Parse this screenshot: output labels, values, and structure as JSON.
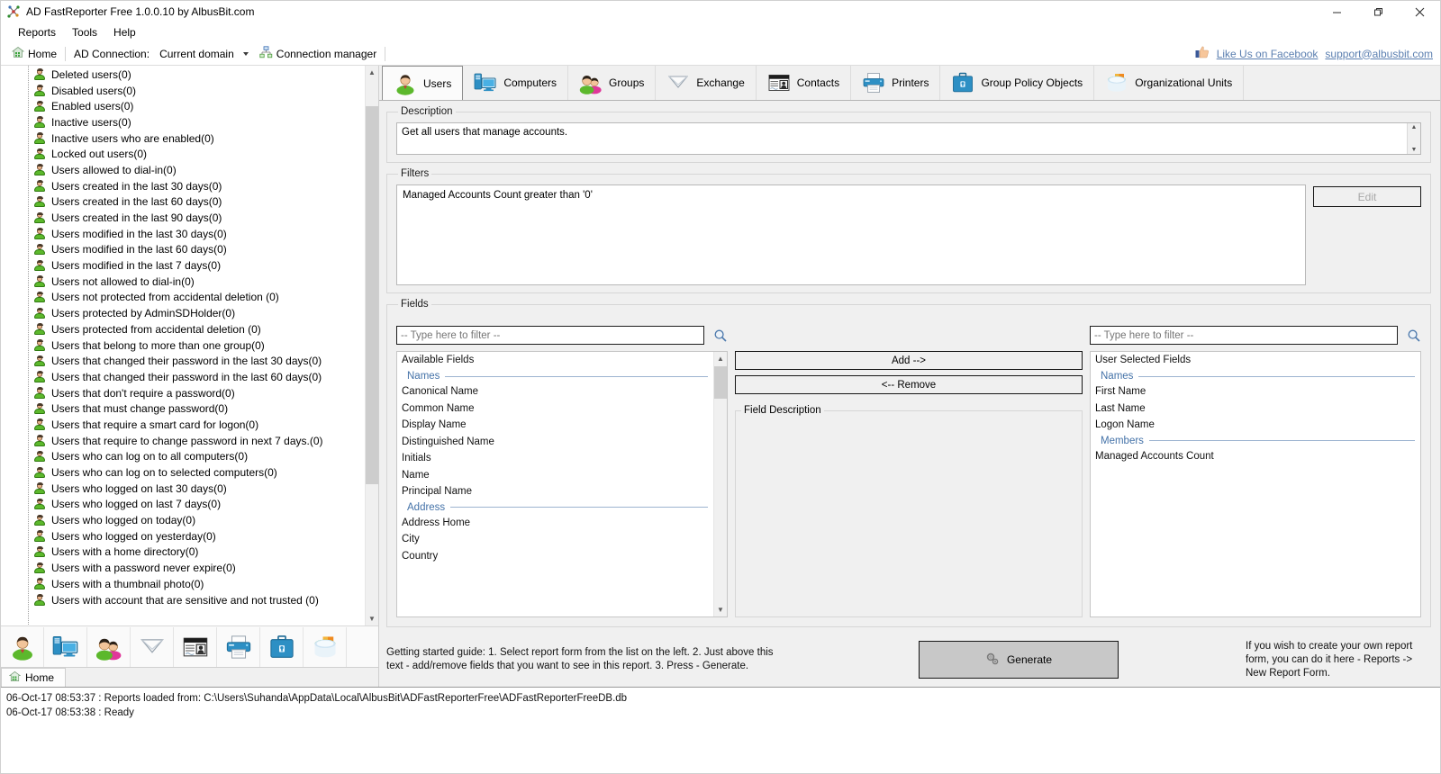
{
  "window": {
    "title": "AD FastReporter Free 1.0.0.10 by AlbusBit.com",
    "minimize": "–",
    "maximize": "❐",
    "close": "✕"
  },
  "menu": {
    "items": [
      {
        "label": "Reports"
      },
      {
        "label": "Tools"
      },
      {
        "label": "Help"
      }
    ]
  },
  "toolbar": {
    "home_label": "Home",
    "ad_connection_label": "AD Connection:",
    "connection_value": "Current domain",
    "connection_manager_label": "Connection manager",
    "facebook_link": "Like Us on Facebook",
    "support_link": "support@albusbit.com"
  },
  "tree": {
    "items": [
      {
        "label": "Deleted users(0)"
      },
      {
        "label": "Disabled users(0)"
      },
      {
        "label": "Enabled users(0)"
      },
      {
        "label": "Inactive users(0)"
      },
      {
        "label": "Inactive users who are enabled(0)"
      },
      {
        "label": "Locked out users(0)"
      },
      {
        "label": "Users allowed to dial-in(0)"
      },
      {
        "label": "Users created in the last 30 days(0)"
      },
      {
        "label": "Users created in the last 60 days(0)"
      },
      {
        "label": "Users created in the last 90 days(0)"
      },
      {
        "label": "Users modified in the last 30 days(0)"
      },
      {
        "label": "Users modified in the last 60 days(0)"
      },
      {
        "label": "Users modified in the last 7 days(0)"
      },
      {
        "label": "Users not allowed to dial-in(0)"
      },
      {
        "label": "Users not protected from accidental deletion (0)"
      },
      {
        "label": "Users protected by AdminSDHolder(0)"
      },
      {
        "label": "Users protected from accidental deletion (0)"
      },
      {
        "label": "Users that belong to more than one group(0)"
      },
      {
        "label": "Users that changed their password in the last 30 days(0)"
      },
      {
        "label": "Users that changed their password in the last 60 days(0)"
      },
      {
        "label": "Users that don't require a password(0)"
      },
      {
        "label": "Users that must change password(0)"
      },
      {
        "label": "Users that require a smart card for logon(0)"
      },
      {
        "label": "Users that require to change password in next 7 days.(0)"
      },
      {
        "label": "Users who can log on to all computers(0)"
      },
      {
        "label": "Users who can log on to selected computers(0)"
      },
      {
        "label": "Users who logged on last 30 days(0)"
      },
      {
        "label": "Users who logged on last 7 days(0)"
      },
      {
        "label": "Users who logged on today(0)"
      },
      {
        "label": "Users who logged on yesterday(0)"
      },
      {
        "label": "Users with a home directory(0)"
      },
      {
        "label": "Users with a password never expire(0)"
      },
      {
        "label": "Users with a thumbnail photo(0)"
      },
      {
        "label": "Users with account that are sensitive and not trusted (0)"
      }
    ]
  },
  "category_strip": {
    "icons": [
      {
        "name": "users-icon"
      },
      {
        "name": "computers-icon"
      },
      {
        "name": "groups-icon"
      },
      {
        "name": "exchange-icon"
      },
      {
        "name": "contacts-icon"
      },
      {
        "name": "printers-icon"
      },
      {
        "name": "group-policy-objects-icon"
      },
      {
        "name": "organizational-units-icon"
      }
    ]
  },
  "home_tab": {
    "label": "Home"
  },
  "tabs": [
    {
      "label": "Users",
      "icon": "users-icon",
      "active": true
    },
    {
      "label": "Computers",
      "icon": "computers-icon",
      "active": false
    },
    {
      "label": "Groups",
      "icon": "groups-icon",
      "active": false
    },
    {
      "label": "Exchange",
      "icon": "exchange-icon",
      "active": false
    },
    {
      "label": "Contacts",
      "icon": "contacts-icon",
      "active": false
    },
    {
      "label": "Printers",
      "icon": "printers-icon",
      "active": false
    },
    {
      "label": "Group Policy Objects",
      "icon": "group-policy-icon",
      "active": false
    },
    {
      "label": "Organizational Units",
      "icon": "organizational-units-icon",
      "active": false
    }
  ],
  "description": {
    "legend": "Description",
    "text": "Get all users that manage accounts."
  },
  "filters": {
    "legend": "Filters",
    "text": "Managed Accounts Count greater than '0'",
    "edit_button": "Edit"
  },
  "fields": {
    "legend": "Fields",
    "available": {
      "filter_placeholder": "-- Type here to filter --",
      "filter_value": "",
      "header": "Available Fields",
      "groups": [
        {
          "name": "Names",
          "items": [
            "Canonical Name",
            "Common Name",
            "Display Name",
            "Distinguished Name",
            "Initials",
            "Name",
            "Principal Name"
          ]
        },
        {
          "name": "Address",
          "items": [
            "Address Home",
            "City",
            "Country"
          ]
        }
      ]
    },
    "selected": {
      "filter_placeholder": "-- Type here to filter --",
      "filter_value": "",
      "header": "User Selected Fields",
      "groups": [
        {
          "name": "Names",
          "items": [
            "First Name",
            "Last Name",
            "Logon Name"
          ]
        },
        {
          "name": "Members",
          "items": [
            "Managed Accounts Count"
          ]
        }
      ]
    },
    "add_button": "Add -->",
    "remove_button": "<-- Remove",
    "field_description_legend": "Field Description",
    "field_description_text": ""
  },
  "footer": {
    "guide_text": "Getting started guide: 1. Select report form from the list on the left. 2. Just above this text - add/remove fields that you want to see in this report. 3. Press - Generate.",
    "generate_label": "Generate",
    "create_text": "If you wish to create your own report form, you can do it here - Reports -> New Report Form."
  },
  "status_log": {
    "lines": [
      "06-Oct-17 08:53:37 : Reports loaded from: C:\\Users\\Suhanda\\AppData\\Local\\AlbusBit\\ADFastReporterFree\\ADFastReporterFreeDB.db",
      "06-Oct-17 08:53:38 : Ready"
    ]
  },
  "colors": {
    "accent_link": "#5b7fb0",
    "group_header": "#4472a8",
    "user_green": "#5cb82c",
    "tab_active_bg": "#fbfbfb"
  }
}
